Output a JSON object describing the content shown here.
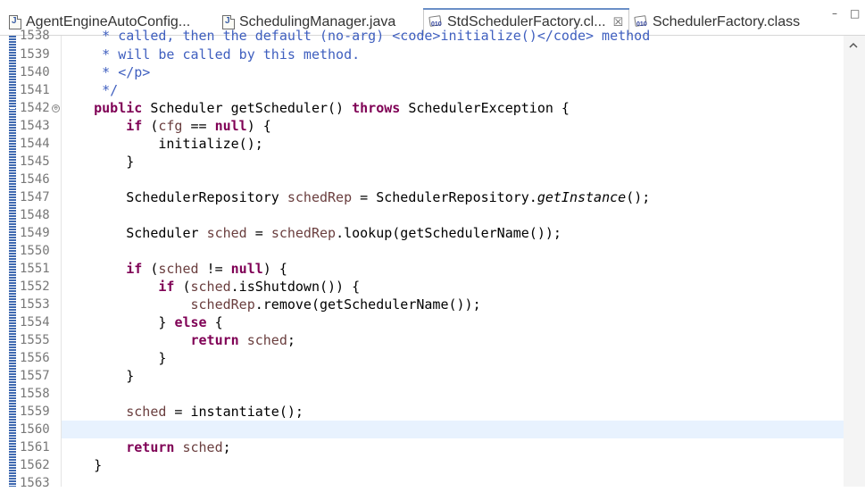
{
  "tabs": [
    {
      "label": "AgentEngineAutoConfig...",
      "icon": "java-file-icon",
      "active": false
    },
    {
      "label": "SchedulingManager.java",
      "icon": "java-file-icon",
      "active": false
    },
    {
      "label": "StdSchedulerFactory.cl...",
      "icon": "class-file-icon",
      "active": true,
      "close": "☒"
    },
    {
      "label": "SchedulerFactory.class",
      "icon": "class-file-icon",
      "active": false
    }
  ],
  "window_controls": {
    "minimize": "–",
    "maximize": "□"
  },
  "editor": {
    "line_numbers": [
      "1538",
      "1539",
      "1540",
      "1541",
      "1542",
      "1543",
      "1544",
      "1545",
      "1546",
      "1547",
      "1548",
      "1549",
      "1550",
      "1551",
      "1552",
      "1553",
      "1554",
      "1555",
      "1556",
      "1557",
      "1558",
      "1559",
      "1560",
      "1561",
      "1562",
      "1563"
    ],
    "current_line": "1560",
    "fold_marker": "⊖",
    "code": {
      "l1538": "     * called, then the default (no-arg) <code>initialize()</code> method",
      "l1539": "     * will be called by this method.",
      "l1540": "     * </p>",
      "l1541": "     */",
      "l1542_kw1": "public",
      "l1542_rest1": " Scheduler getScheduler() ",
      "l1542_kw2": "throws",
      "l1542_rest2": " SchedulerException {",
      "l1543_kw": "if",
      "l1543_a": " (",
      "l1543_var": "cfg",
      "l1543_b": " == ",
      "l1543_kw2": "null",
      "l1543_c": ") {",
      "l1544": "initialize();",
      "l1545": "}",
      "l1547_a": "SchedulerRepository ",
      "l1547_var": "schedRep",
      "l1547_b": " = SchedulerRepository.",
      "l1547_it": "getInstance",
      "l1547_c": "();",
      "l1549_a": "Scheduler ",
      "l1549_var": "sched",
      "l1549_b": " = ",
      "l1549_var2": "schedRep",
      "l1549_c": ".lookup(getSchedulerName());",
      "l1551_kw": "if",
      "l1551_a": " (",
      "l1551_var": "sched",
      "l1551_b": " != ",
      "l1551_kw2": "null",
      "l1551_c": ") {",
      "l1552_kw": "if",
      "l1552_a": " (",
      "l1552_var": "sched",
      "l1552_b": ".isShutdown()) {",
      "l1553_var": "schedRep",
      "l1553_b": ".remove(getSchedulerName());",
      "l1554_a": "} ",
      "l1554_kw": "else",
      "l1554_b": " {",
      "l1555_kw": "return",
      "l1555_var": " sched",
      "l1555_b": ";",
      "l1556": "}",
      "l1557": "}",
      "l1559_var": "sched",
      "l1559_b": " = instantiate();",
      "l1561_kw": "return",
      "l1561_var": " sched",
      "l1561_b": ";",
      "l1562": "}"
    }
  }
}
